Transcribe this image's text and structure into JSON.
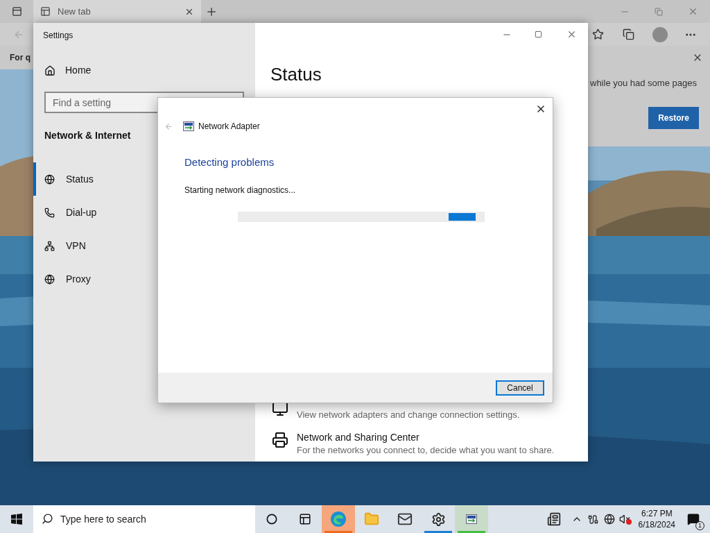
{
  "browser": {
    "tab": {
      "title": "New tab"
    },
    "info_bar": {
      "text": "For q"
    },
    "restore_notice": {
      "text": "while you had some pages",
      "button": "Restore"
    }
  },
  "settings": {
    "title": "Settings",
    "home": "Home",
    "search": {
      "placeholder": "Find a setting"
    },
    "section": "Network & Internet",
    "nav": [
      {
        "label": "Status",
        "selected": true
      },
      {
        "label": "Dial-up",
        "selected": false
      },
      {
        "label": "VPN",
        "selected": false
      },
      {
        "label": "Proxy",
        "selected": false
      }
    ],
    "heading": "Status",
    "links": [
      {
        "description": "View network adapters and change connection settings."
      },
      {
        "title": "Network and Sharing Center",
        "description": "For the networks you connect to, decide what you want to share."
      }
    ]
  },
  "dialog": {
    "title": "Network Adapter",
    "heading": "Detecting problems",
    "status": "Starting network diagnostics...",
    "progress": {
      "indeterminate": true
    },
    "button": "Cancel"
  },
  "taskbar": {
    "search": {
      "placeholder": "Type here to search"
    },
    "apps": [
      {
        "flashing": true,
        "running": true,
        "selected": false
      },
      {
        "flashing": false,
        "running": false,
        "selected": false
      },
      {
        "flashing": false,
        "running": false,
        "selected": false
      },
      {
        "flashing": false,
        "running": true,
        "selected": false
      },
      {
        "flashing": false,
        "running": true,
        "selected": true
      }
    ],
    "volume_muted": true,
    "time": "6:27 PM",
    "date": "6/18/2024",
    "notifications": "1"
  }
}
